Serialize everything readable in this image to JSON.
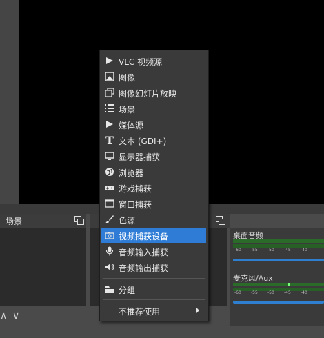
{
  "docks": {
    "scenes_title": "场景"
  },
  "toolbar": {
    "up_glyph": "∧",
    "down_glyph": "∨"
  },
  "mixer": {
    "channels": [
      {
        "name": "桌面音频",
        "level": 0.0,
        "fader": 1.0
      },
      {
        "name": "麦克风/Aux",
        "level": 0.6,
        "fader": 1.0
      }
    ],
    "scale_ticks": [
      "-60",
      "-55",
      "-50",
      "-45",
      "-40"
    ],
    "meter_color": "#2a6b2a",
    "fader_color": "#2f7fd0"
  },
  "add_source_menu": {
    "items": [
      {
        "label": "VLC 视频源",
        "icon": "play-icon"
      },
      {
        "label": "图像",
        "icon": "image-icon"
      },
      {
        "label": "图像幻灯片放映",
        "icon": "slideshow-icon"
      },
      {
        "label": "场景",
        "icon": "list-icon"
      },
      {
        "label": "媒体源",
        "icon": "play-icon"
      },
      {
        "label": "文本 (GDI+)",
        "icon": "text-icon"
      },
      {
        "label": "显示器捕获",
        "icon": "monitor-icon"
      },
      {
        "label": "浏览器",
        "icon": "globe-icon"
      },
      {
        "label": "游戏捕获",
        "icon": "gamepad-icon"
      },
      {
        "label": "窗口捕获",
        "icon": "window-icon"
      },
      {
        "label": "色源",
        "icon": "brush-icon"
      },
      {
        "label": "视频捕获设备",
        "icon": "camera-icon",
        "selected": true
      },
      {
        "label": "音频输入捕获",
        "icon": "microphone-icon"
      },
      {
        "label": "音频输出捕获",
        "icon": "speaker-icon"
      }
    ],
    "group_label": "分组",
    "group_icon": "folder-icon",
    "deprecated_label": "不推荐使用",
    "selected_color": "#2e7cd6"
  }
}
